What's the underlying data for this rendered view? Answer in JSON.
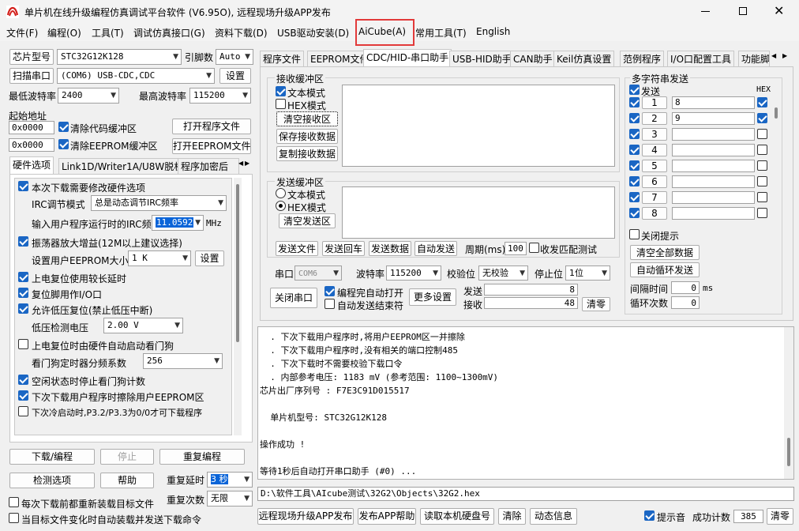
{
  "window": {
    "title": "单片机在线升级编程仿真调试平台软件 (V6.95O), 远程现场升级APP发布",
    "min_icon": "minimize-icon",
    "max_icon": "maximize-icon",
    "close_icon": "close-icon"
  },
  "menu": [
    "文件(F)",
    "编程(O)",
    "工具(T)",
    "调试仿真接口(G)",
    "资料下载(D)",
    "USB驱动安装(D)",
    "AiCube(A)",
    "常用工具(T)",
    "English"
  ],
  "left": {
    "chip_btn": "芯片型号",
    "chip_value": "STC32G12K128",
    "pin_label": "引脚数",
    "pin_value": "Auto",
    "scan_btn": "扫描串口",
    "port_value": "(COM6) USB-CDC,CDC",
    "settings_btn": "设置",
    "min_baud_label": "最低波特率",
    "min_baud_value": "2400",
    "max_baud_label": "最高波特率",
    "max_baud_value": "115200",
    "start_addr_label": "起始地址",
    "addr1": "0x0000",
    "clear_code_label": "清除代码缓冲区",
    "open_prog_btn": "打开程序文件",
    "addr2": "0x0000",
    "clear_eeprom_label": "清除EEPROM缓冲区",
    "open_eeprom_btn": "打开EEPROM文件",
    "tabs": [
      "硬件选项",
      "Link1D/Writer1A/U8W脱机",
      "程序加密后"
    ],
    "hw": {
      "modify_hw": "本次下载需要修改硬件选项",
      "irc_mode_label": "IRC调节模式",
      "irc_mode_value": "总是动态调节IRC频率",
      "irc_freq_label": "输入用户程序运行时的IRC频率",
      "irc_freq_value": "11.0592",
      "irc_unit": "MHz",
      "osc_gain": "振荡器放大增益(12M以上建议选择)",
      "eeprom_size_label": "设置用户EEPROM大小",
      "eeprom_size_value": "1   K",
      "eeprom_set_btn": "设置",
      "reset_delay": "上电复位使用较长延时",
      "reset_pin": "复位脚用作I/O口",
      "lvr": "允许低压复位(禁止低压中断)",
      "lvd_label": "低压检测电压",
      "lvd_value": "2.00 V",
      "wdt_auto": "上电复位时由硬件自动启动看门狗",
      "wdt_div_label": "看门狗定时器分频系数",
      "wdt_div_value": "256",
      "idle_wdt": "空闲状态时停止看门狗计数",
      "erase_eeprom": "下次下载用户程序时擦除用户EEPROM区",
      "cold_boot": "下次冷启动时,P3.2/P3.3为0/0才可下载程序"
    },
    "download_btn": "下载/编程",
    "stop_btn": "停止",
    "reprogram_btn": "重复编程",
    "check_btn": "检测选项",
    "help_btn": "帮助",
    "repeat_delay_label": "重复延时",
    "repeat_delay_value": "3 秒",
    "repeat_count_label": "重复次数",
    "repeat_count_value": "无限",
    "reload_label": "每次下载前都重新装载目标文件",
    "autosend_label": "当目标文件变化时自动装载并发送下载命令"
  },
  "right": {
    "tabs": [
      "程序文件",
      "EEPROM文件",
      "CDC/HID-串口助手",
      "USB-HID助手",
      "CAN助手",
      "Keil仿真设置",
      "范例程序",
      "I/O口配置工具",
      "功能脚"
    ],
    "active_tab": 2,
    "recv": {
      "title": "接收缓冲区",
      "text_mode": "文本模式",
      "hex_mode": "HEX模式",
      "clear_btn": "清空接收区",
      "save_btn": "保存接收数据",
      "copy_btn": "复制接收数据"
    },
    "send": {
      "title": "发送缓冲区",
      "text_mode": "文本模式",
      "hex_mode": "HEX模式",
      "clear_btn": "清空发送区",
      "file_btn": "发送文件",
      "enter_btn": "发送回车",
      "data_btn": "发送数据",
      "auto_btn": "自动发送",
      "period_label": "周期(ms)",
      "period_value": "100",
      "match_label": "收发匹配测试"
    },
    "multi": {
      "title": "多字符串发送",
      "send_label": "发送",
      "hex_label": "HEX",
      "rows": [
        {
          "n": "1",
          "val": "8",
          "on": true,
          "hex": true
        },
        {
          "n": "2",
          "val": "9",
          "on": true,
          "hex": true
        },
        {
          "n": "3",
          "val": "",
          "on": true,
          "hex": false
        },
        {
          "n": "4",
          "val": "",
          "on": true,
          "hex": false
        },
        {
          "n": "5",
          "val": "",
          "on": true,
          "hex": false
        },
        {
          "n": "6",
          "val": "",
          "on": true,
          "hex": false
        },
        {
          "n": "7",
          "val": "",
          "on": true,
          "hex": false
        },
        {
          "n": "8",
          "val": "",
          "on": true,
          "hex": false
        }
      ],
      "close_hint": "关闭提示",
      "clear_all_btn": "清空全部数据",
      "auto_loop_btn": "自动循环发送",
      "interval_label": "间隔时间",
      "interval_value": "0",
      "interval_unit": "ms",
      "loop_label": "循环次数",
      "loop_value": "0"
    },
    "port_label": "串口",
    "port_value": "COM6",
    "baud_label": "波特率",
    "baud_value": "115200",
    "parity_label": "校验位",
    "parity_value": "无校验",
    "stop_label": "停止位",
    "stop_value": "1位",
    "close_port_btn": "关闭串口",
    "open_after_label": "编程完自动打开",
    "auto_end_label": "自动发送结束符",
    "more_btn": "更多设置",
    "sent_label": "发送",
    "sent_value": "8",
    "recv_label": "接收",
    "recv_value": "48",
    "clear_count_btn": "清零"
  },
  "log": [
    "  . 下次下载用户程序时,将用户EEPROM区一并擦除",
    "  . 下次下载用户程序时,没有相关的端口控制485",
    "  . 下次下载时不需要校验下载口令",
    "  . 内部参考电压: 1183 mV (参考范围: 1100~1300mV)",
    "芯片出厂序列号 : F7E3C91D015517",
    "",
    "  单片机型号: STC32G12K128",
    "",
    "操作成功 !",
    "",
    "等待1秒后自动打开串口助手 (#0) ..."
  ],
  "path": "D:\\软件工具\\AIcube测试\\32G2\\Objects\\32G2.hex",
  "bottom": {
    "remote_btn": "远程现场升级APP发布",
    "publish_help_btn": "发布APP帮助",
    "read_disk_btn": "读取本机硬盘号",
    "clear_btn": "清除",
    "info_btn": "动态信息",
    "sound_label": "提示音",
    "success_label": "成功计数",
    "success_value": "385",
    "reset_btn": "清零"
  },
  "colors": {
    "highlight": "#e23a3a",
    "check": "#1a66c4",
    "select": "#0a64d8"
  }
}
